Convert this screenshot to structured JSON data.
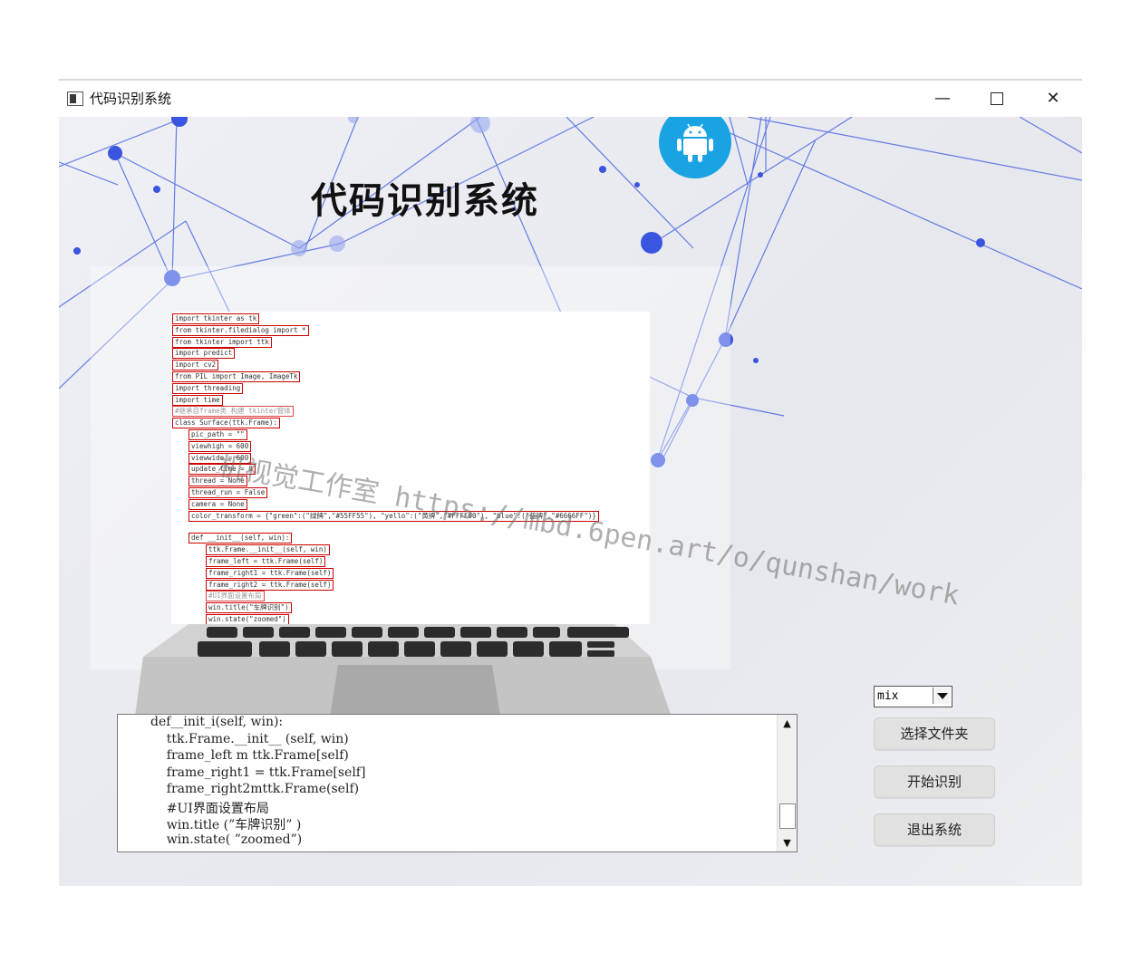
{
  "window": {
    "title": "代码识别系统",
    "controls": {
      "minimize": "—",
      "close": "✕"
    }
  },
  "header": {
    "title": "代码识别系统"
  },
  "watermark": "机视觉工作室 https://mbd.6pen.art/o/qunshan/work",
  "preview": {
    "lines": [
      {
        "text": "import tkinter as tk",
        "comment": false
      },
      {
        "text": "from tkinter.filedialog import *",
        "comment": false
      },
      {
        "text": "from tkinter import ttk",
        "comment": false
      },
      {
        "text": "import predict",
        "comment": false
      },
      {
        "text": "import cv2",
        "comment": false
      },
      {
        "text": "from PIL import Image, ImageTk",
        "comment": false
      },
      {
        "text": "import threading",
        "comment": false
      },
      {
        "text": "import time",
        "comment": false
      },
      {
        "text": "#继承自frame类 构建 tkinter窗体",
        "comment": true
      },
      {
        "text": "class Surface(ttk.Frame):",
        "comment": false
      },
      {
        "text": "pic_path = \"\"",
        "comment": false
      },
      {
        "text": "viewhigh = 600",
        "comment": false
      },
      {
        "text": "viewwide = 600",
        "comment": false
      },
      {
        "text": "update_time = 0",
        "comment": false
      },
      {
        "text": "thread = None",
        "comment": false
      },
      {
        "text": "thread_run = False",
        "comment": false
      },
      {
        "text": "camera = None",
        "comment": false
      },
      {
        "text": "color_transform = {\"green\":(\"绿牌\",\"#55FF55\"), \"yello\":(\"黄牌\",\"#FFFF00\"), \"blue\":(\"蓝牌\",\"#6666FF\")}",
        "comment": false
      },
      {
        "text": "def __init__(self, win):",
        "comment": false
      },
      {
        "text": "ttk.Frame.__init__(self, win)",
        "comment": false
      },
      {
        "text": "frame_left = ttk.Frame(self)",
        "comment": false
      },
      {
        "text": "frame_right1 = ttk.Frame(self)",
        "comment": false
      },
      {
        "text": "frame_right2 = ttk.Frame(self)",
        "comment": false
      },
      {
        "text": "#UI界面设置布局",
        "comment": true
      },
      {
        "text": "win.title(\"车牌识别\")",
        "comment": false
      },
      {
        "text": "win.state(\"zoomed\")",
        "comment": false
      }
    ]
  },
  "result_text": {
    "lines": [
      "def__init_i(self, win):",
      "    ttk.Frame.__init__ (self, win)",
      "    frame_left m ttk.Frame[self)",
      "    frame_right1 = ttk.Frame[self]",
      "    frame_right2mttk.Frame(self)",
      "    #UI界面设置布局",
      "    win.title (”车牌识别” )",
      "    win.state( ”zoomed”)"
    ]
  },
  "mode_select": {
    "value": "mix"
  },
  "buttons": {
    "select_folder": "选择文件夹",
    "start": "开始识别",
    "exit": "退出系统"
  },
  "colors": {
    "accent": "#19a3e3",
    "network": "#3a56e0",
    "highlight_box": "#cc0000"
  }
}
